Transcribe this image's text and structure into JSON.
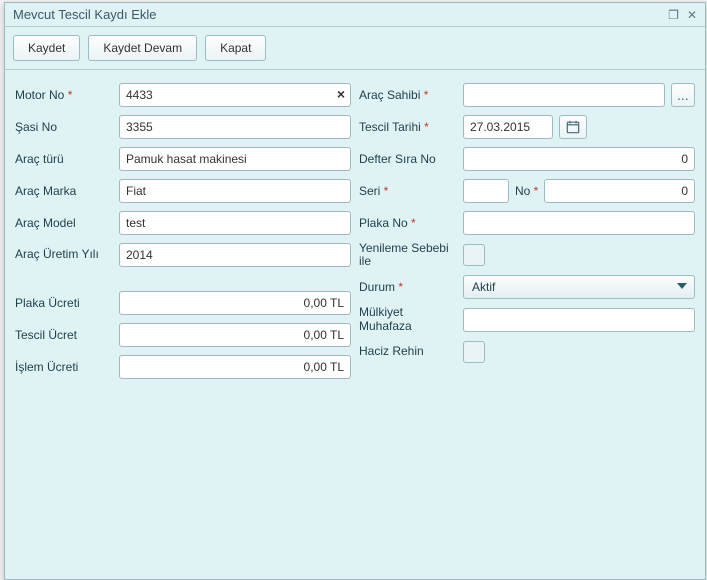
{
  "window": {
    "title": "Mevcut Tescil Kaydı Ekle"
  },
  "toolbar": {
    "save": "Kaydet",
    "save_continue": "Kaydet Devam",
    "close": "Kapat"
  },
  "left": {
    "motor_no_label": "Motor No",
    "motor_no_value": "4433",
    "sasi_no_label": "Şasi No",
    "sasi_no_value": "3355",
    "arac_turu_label": "Araç türü",
    "arac_turu_value": "Pamuk hasat makinesi",
    "arac_marka_label": "Araç Marka",
    "arac_marka_value": "Fiat",
    "arac_model_label": "Araç Model",
    "arac_model_value": "test",
    "arac_uretim_label": "Araç Üretim Yılı",
    "arac_uretim_value": "2014",
    "plaka_ucreti_label": "Plaka Ücreti",
    "plaka_ucreti_value": "0,00 TL",
    "tescil_ucret_label": "Tescil Ücret",
    "tescil_ucret_value": "0,00 TL",
    "islem_ucreti_label": "İşlem Ücreti",
    "islem_ucreti_value": "0,00 TL"
  },
  "right": {
    "arac_sahibi_label": "Araç Sahibi",
    "arac_sahibi_lookup": "...",
    "tescil_tarihi_label": "Tescil Tarihi",
    "tescil_tarihi_value": "27.03.2015",
    "defter_sira_label": "Defter Sıra No",
    "defter_sira_value": "0",
    "seri_label": "Seri",
    "seri_value": "",
    "no_label": "No",
    "no_value": "0",
    "plaka_no_label": "Plaka No",
    "plaka_no_value": "",
    "yenileme_label": "Yenileme Sebebi ile",
    "durum_label": "Durum",
    "durum_value": "Aktif",
    "mulkiye_label": "Mülkiyet Muhafaza",
    "mulkiye_value": "",
    "haciz_label": "Haciz Rehin"
  }
}
